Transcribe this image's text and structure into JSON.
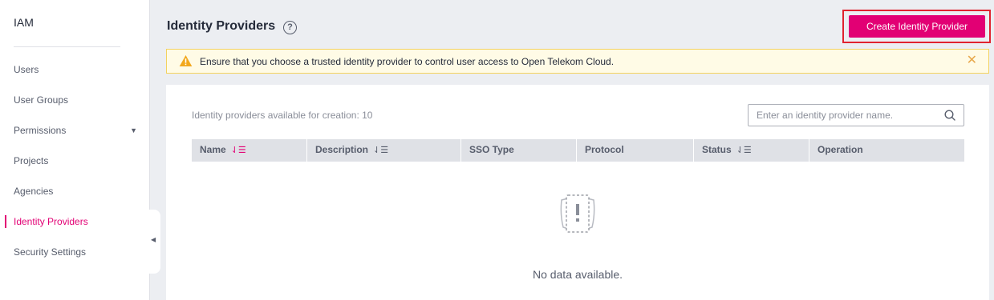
{
  "sidebar": {
    "title": "IAM",
    "items": [
      {
        "label": "Users"
      },
      {
        "label": "User Groups"
      },
      {
        "label": "Permissions",
        "caret": "▼"
      },
      {
        "label": "Projects"
      },
      {
        "label": "Agencies"
      },
      {
        "label": "Identity Providers",
        "active": true
      },
      {
        "label": "Security Settings"
      }
    ],
    "collapse_glyph": "◀"
  },
  "header": {
    "title": "Identity Providers",
    "help_glyph": "?",
    "create_button": "Create Identity Provider"
  },
  "alert": {
    "text": "Ensure that you choose a trusted identity provider to control user access to Open Telekom Cloud.",
    "close_glyph": "✕"
  },
  "panel": {
    "available_text": "Identity providers available for creation: 10",
    "search": {
      "placeholder": "Enter an identity provider name.",
      "value": ""
    },
    "columns": [
      {
        "label": "Name",
        "sort": "⇃☰"
      },
      {
        "label": "Description",
        "sort": "⇃☰"
      },
      {
        "label": "SSO Type"
      },
      {
        "label": "Protocol"
      },
      {
        "label": "Status",
        "sort": "⇃☰"
      },
      {
        "label": "Operation"
      }
    ],
    "empty_text": "No data available."
  },
  "colors": {
    "brand": "#e20074",
    "highlight_border": "#e0232f",
    "alert_bg": "#fffbe6",
    "alert_border": "#f3d25f"
  }
}
